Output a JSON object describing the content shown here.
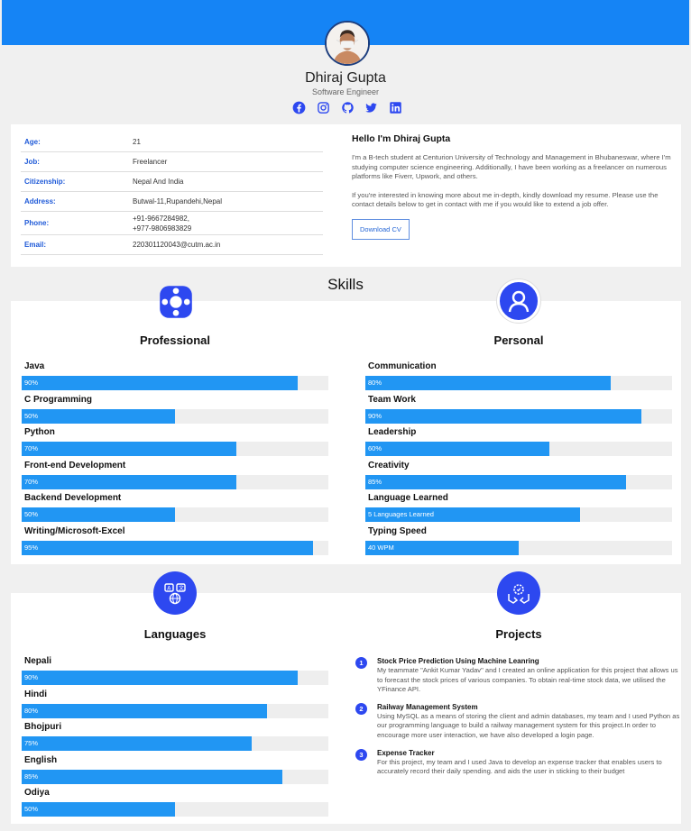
{
  "profile": {
    "name": "Dhiraj Gupta",
    "role": "Software Engineer",
    "social": [
      "facebook-icon",
      "instagram-icon",
      "github-icon",
      "twitter-icon",
      "linkedin-icon"
    ]
  },
  "info": [
    {
      "key": "Age:",
      "value": "21"
    },
    {
      "key": "Job:",
      "value": "Freelancer"
    },
    {
      "key": "Citizenship:",
      "value": "Nepal And India"
    },
    {
      "key": "Address:",
      "value": "Butwal-11,Rupandehi,Nepal"
    },
    {
      "key": "Phone:",
      "value": "+91-9667284982,\n+977-9806983829"
    },
    {
      "key": "Email:",
      "value": "220301120043@cutm.ac.in"
    }
  ],
  "about": {
    "heading": "Hello I'm Dhiraj Gupta",
    "paragraph1": "I'm a B-tech student at Centurion University of Technology and Management in Bhubaneswar, where I'm studying computer science engineering. Additionally, I have been working as a freelancer on numerous platforms like Fiverr, Upwork, and others.",
    "paragraph2": "If you're interested in knowing more about me in-depth, kindly download my resume. Please use the contact details below to get in contact with me if you would like to extend a job offer.",
    "button": "Download CV"
  },
  "skills_title": "Skills",
  "professional": {
    "title": "Professional",
    "items": [
      {
        "label": "Java",
        "value": 90,
        "text": "90%"
      },
      {
        "label": "C Programming",
        "value": 50,
        "text": "50%"
      },
      {
        "label": "Python",
        "value": 70,
        "text": "70%"
      },
      {
        "label": "Front-end Development",
        "value": 70,
        "text": "70%"
      },
      {
        "label": "Backend Development",
        "value": 50,
        "text": "50%"
      },
      {
        "label": "Writing/Microsoft-Excel",
        "value": 95,
        "text": "95%"
      }
    ]
  },
  "personal": {
    "title": "Personal",
    "items": [
      {
        "label": "Communication",
        "value": 80,
        "text": "80%"
      },
      {
        "label": "Team Work",
        "value": 90,
        "text": "90%"
      },
      {
        "label": "Leadership",
        "value": 60,
        "text": "60%"
      },
      {
        "label": "Creativity",
        "value": 85,
        "text": "85%"
      },
      {
        "label": "Language Learned",
        "value": 70,
        "text": "5 Languages Learned"
      },
      {
        "label": "Typing Speed",
        "value": 50,
        "text": "40 WPM"
      }
    ]
  },
  "languages": {
    "title": "Languages",
    "items": [
      {
        "label": "Nepali",
        "value": 90,
        "text": "90%"
      },
      {
        "label": "Hindi",
        "value": 80,
        "text": "80%"
      },
      {
        "label": "Bhojpuri",
        "value": 75,
        "text": "75%"
      },
      {
        "label": "English",
        "value": 85,
        "text": "85%"
      },
      {
        "label": "Odiya",
        "value": 50,
        "text": "50%"
      }
    ]
  },
  "projects": {
    "title": "Projects",
    "items": [
      {
        "num": "1",
        "title": "Stock Price Prediction Using Machine Leanring",
        "desc": "My teammate \"Ankit Kumar Yadav\" and I created an online application for this project that allows us to forecast the stock prices of various companies. To obtain real-time stock data, we utilised the YFinance API."
      },
      {
        "num": "2",
        "title": "Railway Management System",
        "desc": "Using MySQL as a means of storing the client and admin databases, my team and I used Python as our programming language to build a railway management system for this project.In order to encourage more user interaction, we have also developed a login page."
      },
      {
        "num": "3",
        "title": "Expense Tracker",
        "desc": "For this project, my team and I used Java to develop an expense tracker that enables users to accurately record their daily spending. and aids the user in sticking to their budget"
      }
    ]
  },
  "colors": {
    "accent": "#1584f5",
    "bar": "#2196f3",
    "icon_bg": "#2d48f0",
    "label_blue": "#1f5ad8"
  }
}
